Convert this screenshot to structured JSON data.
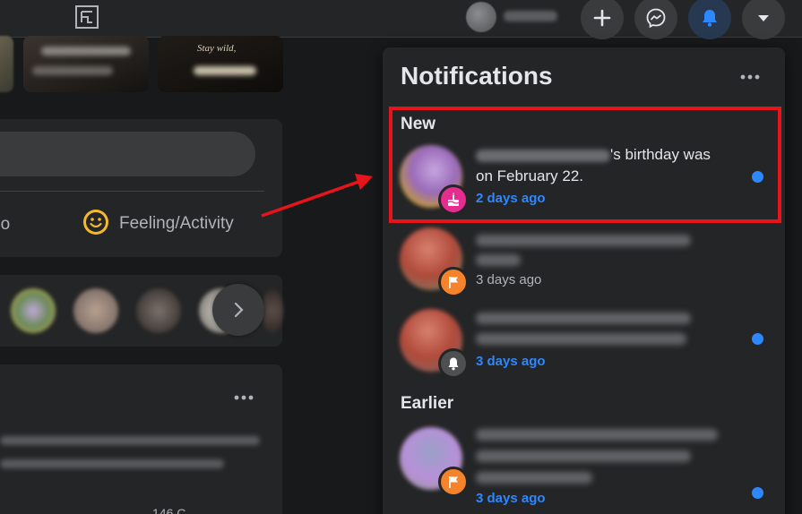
{
  "topbar": {
    "icons": [
      "facebook-gaming-icon",
      "plus-icon",
      "messenger-icon",
      "bell-icon",
      "caret-down-icon"
    ],
    "accent_color": "#2d88ff"
  },
  "feed": {
    "feeling_label": "Feeling/Activity",
    "partial_label": "eo",
    "story_text": "Stay wild,",
    "post_meta": "146 C"
  },
  "notifications": {
    "title": "Notifications",
    "sections": {
      "new": "New",
      "earlier": "Earlier"
    },
    "items": [
      {
        "text_suffix": "'s birthday was",
        "text_line2": "on February 22.",
        "time": "2 days ago",
        "unread": true,
        "badge_icon": "birthday-cake-icon",
        "badge_color": "#e42d8f"
      },
      {
        "time": "3 days ago",
        "unread": false,
        "badge_icon": "flag-icon",
        "badge_color": "#f5832b"
      },
      {
        "time": "3 days ago",
        "unread": true,
        "badge_icon": "bell-icon",
        "badge_color": "#4e4f50"
      },
      {
        "time": "3 days ago",
        "unread": true,
        "badge_icon": "flag-icon",
        "badge_color": "#f5832b"
      }
    ]
  },
  "annotation": {
    "highlight_color": "#e8141b"
  }
}
